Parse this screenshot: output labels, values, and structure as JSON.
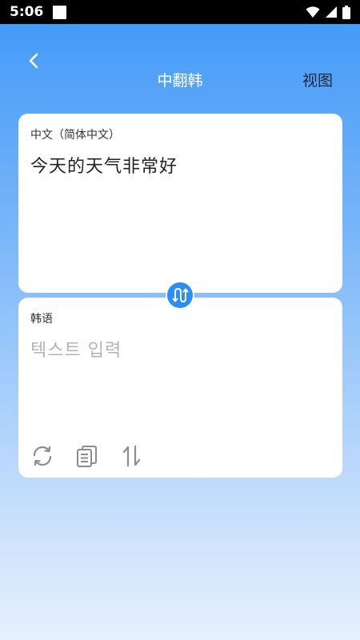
{
  "status": {
    "time": "5:06"
  },
  "header": {
    "title": "中翻韩",
    "view_label": "视图"
  },
  "source": {
    "language": "中文（简体中文）",
    "text": "今天的天气非常好"
  },
  "target": {
    "language": "韩语",
    "placeholder": "텍스트 입력"
  },
  "icons": {
    "back": "back-arrow-icon",
    "swap": "swap-icon",
    "refresh": "refresh-icon",
    "copy": "copy-icon",
    "sort": "swap-vertical-icon"
  },
  "colors": {
    "accent": "#2c8df5",
    "gradient_top": "#3f98f7",
    "gradient_bottom": "#e7f1fd"
  }
}
